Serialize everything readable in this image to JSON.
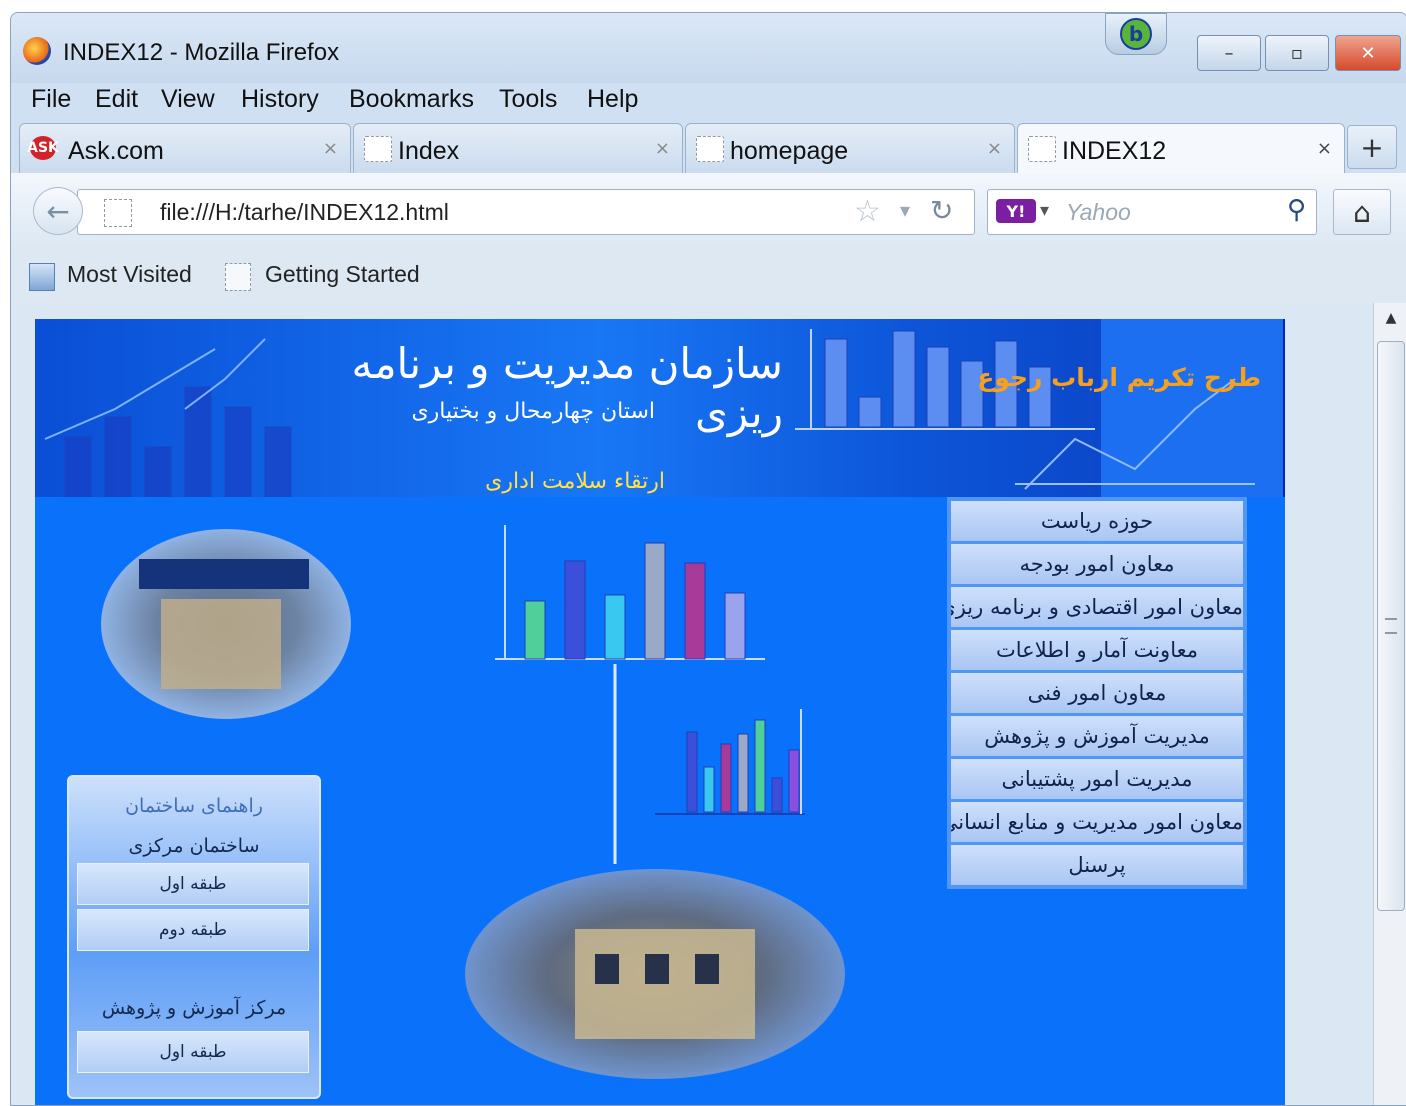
{
  "window": {
    "title": "INDEX12 - Mozilla Firefox",
    "bing_label": "b",
    "minimize_symbol": "–",
    "maximize_symbol": "▫",
    "close_symbol": "✕"
  },
  "menubar": {
    "items": [
      "File",
      "Edit",
      "View",
      "History",
      "Bookmarks",
      "Tools",
      "Help"
    ]
  },
  "tabs": [
    {
      "label": "Ask.com",
      "icon": "ask-logo-icon",
      "active": false
    },
    {
      "label": "Index",
      "icon": "page-icon",
      "active": false
    },
    {
      "label": "homepage",
      "icon": "page-icon",
      "active": false
    },
    {
      "label": "INDEX12",
      "icon": "page-icon",
      "active": true
    }
  ],
  "tab_close_symbol": "×",
  "new_tab_symbol": "+",
  "navbar": {
    "url": "file:///H:/tarhe/INDEX12.html",
    "search_placeholder": "Yahoo",
    "search_engine_label": "Y!",
    "back_symbol": "←",
    "star_symbol": "☆",
    "dropdown_symbol": "▾",
    "reload_symbol": "↻",
    "search_symbol": "⚲",
    "home_symbol": "⌂"
  },
  "bookmarks": [
    {
      "label": "Most Visited",
      "icon": "most-visited-icon"
    },
    {
      "label": "Getting Started",
      "icon": "page-icon"
    }
  ],
  "page": {
    "banner_title": "سازمان مدیریت و برنامه ریزی",
    "banner_subtitle": "استان چهارمحال و بختیاری",
    "banner_right": "طرح تکریم ارباب رجوع",
    "banner_bottom": "ارتقاء سلامت اداری",
    "menu": [
      "حوزه ریاست",
      "معاون امور بودجه",
      "معاون امور اقتصادی و برنامه ریزی",
      "معاونت آمار و اطلاعات",
      "معاون امور فنی",
      "مدیریت آموزش و پژوهش",
      "مدیریت امور پشتیبانی",
      "معاون امور مدیریت و منابع انسانی",
      "پرسنل"
    ],
    "side_box": {
      "title": "راهنمای ساختمان",
      "building_label": "ساختمان مرکزی",
      "floor1": "طبقه اول",
      "floor2": "طبقه دوم",
      "section2_label": "مرکز آموزش و پژوهش",
      "section2_floor1": "طبقه اول"
    },
    "colors": {
      "page_background": "#0a72fa",
      "banner_right_text": "#f7a01e",
      "banner_bottom_text": "#ffe24a"
    }
  },
  "decorative_chart_1": {
    "bar_colors": [
      "#4fcf9a",
      "#3b4fd8",
      "#39c8f0",
      "#9aa9c8",
      "#a83a9a",
      "#9aa4ee"
    ],
    "values": [
      58,
      98,
      64,
      116,
      96,
      66
    ]
  },
  "decorative_chart_2": {
    "bar_colors": [
      "#3b4fd8",
      "#39c8f0",
      "#a83a9a",
      "#9aa9c8",
      "#4fcf9a",
      "#3b4fd8",
      "#8a4fe0"
    ],
    "values": [
      80,
      45,
      68,
      78,
      92,
      34,
      62
    ]
  },
  "banner_chart_values": [
    88,
    30,
    96,
    80,
    66,
    86,
    60
  ]
}
